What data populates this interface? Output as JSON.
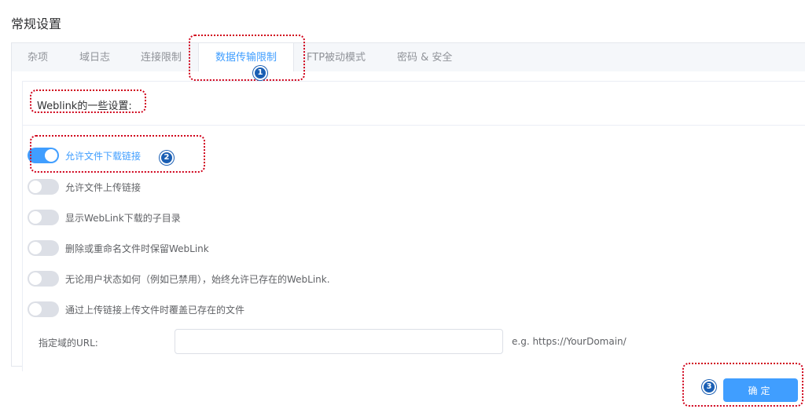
{
  "page": {
    "title": "常规设置"
  },
  "tabs": [
    {
      "label": "杂项"
    },
    {
      "label": "域日志"
    },
    {
      "label": "连接限制"
    },
    {
      "label": "数据传输限制",
      "active": true
    },
    {
      "label": "FTP被动模式"
    },
    {
      "label": "密码 & 安全"
    }
  ],
  "section": {
    "header": "Weblink的一些设置:"
  },
  "options": [
    {
      "label": "允许文件下载链接",
      "enabled": true
    },
    {
      "label": "允许文件上传链接",
      "enabled": false
    },
    {
      "label": "显示WebLink下载的子目录",
      "enabled": false
    },
    {
      "label": "删除或重命名文件时保留WebLink",
      "enabled": false
    },
    {
      "label": "无论用户状态如何（例如已禁用），始终允许已存在的WebLink.",
      "enabled": false
    },
    {
      "label": "通过上传链接上传文件时覆盖已存在的文件",
      "enabled": false
    }
  ],
  "domain_url": {
    "label": "指定域的URL:",
    "value": "",
    "hint": "e.g. https://YourDomain/"
  },
  "footer": {
    "ok_label": "确定"
  },
  "annotations": {
    "step1": "1",
    "step2": "2",
    "step3": "3"
  },
  "colors": {
    "accent": "#409eff",
    "annotation": "#d0021b",
    "badge": "#1a5fb4"
  }
}
